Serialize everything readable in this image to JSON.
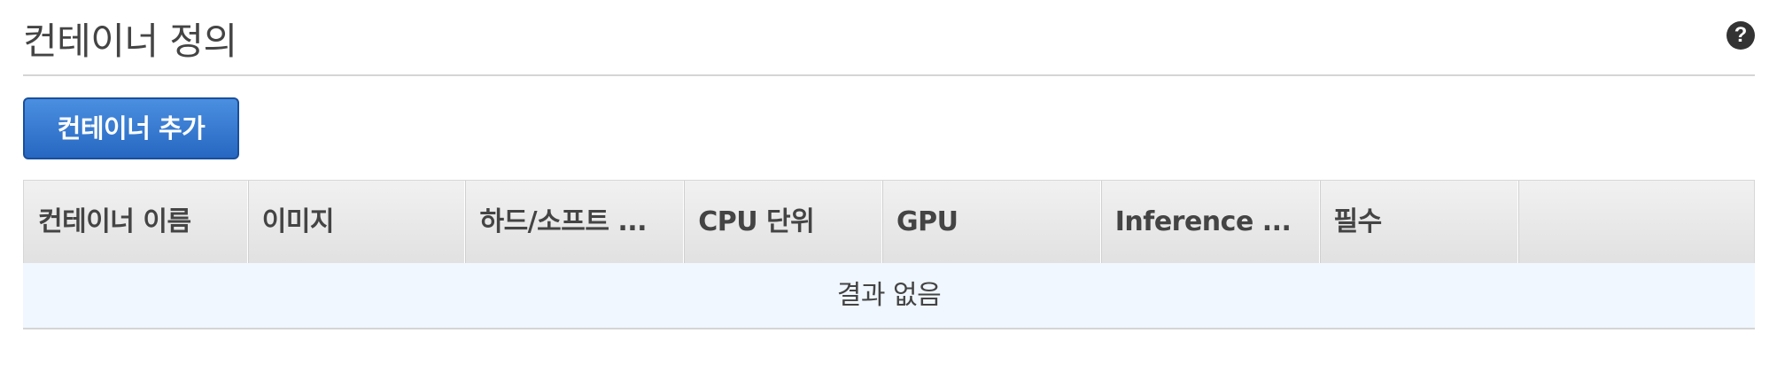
{
  "header": {
    "title": "컨테이너 정의",
    "help_icon": "question-circle-icon",
    "help_glyph": "?"
  },
  "toolbar": {
    "add_container_label": "컨테이너 추가"
  },
  "table": {
    "columns": [
      "컨테이너 이름",
      "이미지",
      "하드/소프트 ...",
      "CPU 단위",
      "GPU",
      "Inference ...",
      "필수",
      ""
    ],
    "empty_message": "결과 없음"
  },
  "colors": {
    "primary_button": "#2767c2",
    "empty_row_background": "#f0f7fe",
    "header_gradient_top": "#f1f1f1",
    "header_gradient_bottom": "#e1e1e1"
  }
}
